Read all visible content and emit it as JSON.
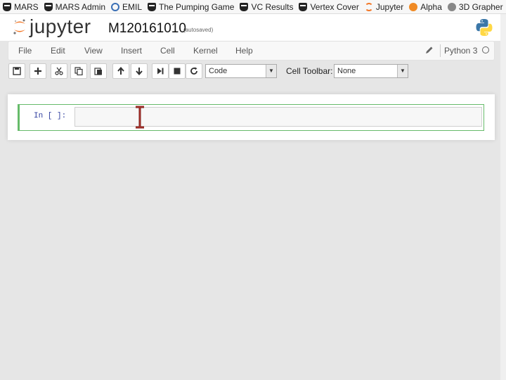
{
  "bookmarks": [
    {
      "label": "MARS",
      "icon": "mars-icon"
    },
    {
      "label": "MARS Admin",
      "icon": "mars-icon"
    },
    {
      "label": "EMIL",
      "icon": "emil-icon"
    },
    {
      "label": "The Pumping Game",
      "icon": "mars-icon"
    },
    {
      "label": "VC Results",
      "icon": "mars-icon"
    },
    {
      "label": "Vertex Cover",
      "icon": "mars-icon"
    },
    {
      "label": "Jupyter",
      "icon": "jupyter-icon"
    },
    {
      "label": "Alpha",
      "icon": "alpha-icon"
    },
    {
      "label": "3D Grapher",
      "icon": "grapher-icon"
    }
  ],
  "header": {
    "logo_text": "jupyter",
    "notebook_name": "M120161010",
    "save_status": "(autosaved)"
  },
  "menubar": {
    "items": [
      "File",
      "Edit",
      "View",
      "Insert",
      "Cell",
      "Kernel",
      "Help"
    ],
    "kernel_name": "Python 3"
  },
  "toolbar": {
    "buttons": [
      "save-icon",
      "add-cell-icon",
      "cut-icon",
      "copy-icon",
      "paste-icon",
      "move-up-icon",
      "move-down-icon",
      "run-icon",
      "stop-icon",
      "restart-icon"
    ],
    "cell_type": "Code",
    "cell_toolbar_label": "Cell Toolbar:",
    "cell_toolbar_value": "None"
  },
  "cell": {
    "prompt": "In [ ]:",
    "content": ""
  },
  "colors": {
    "jupyter_orange": "#f37726",
    "cell_border": "#66bb6a",
    "prompt_blue": "#303f9f",
    "ibeam": "#7a1f1f"
  }
}
